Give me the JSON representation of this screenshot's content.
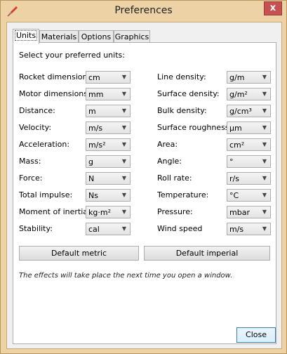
{
  "window": {
    "title": "Preferences",
    "close_glyph": "x"
  },
  "tabs": [
    {
      "label": "Units",
      "active": true
    },
    {
      "label": "Materials",
      "active": false
    },
    {
      "label": "Options",
      "active": false
    },
    {
      "label": "Graphics",
      "active": false
    }
  ],
  "units": {
    "intro": "Select your preferred units:",
    "left": [
      {
        "label": "Rocket dimensions:",
        "value": "cm"
      },
      {
        "label": "Motor dimensions:",
        "value": "mm"
      },
      {
        "label": "Distance:",
        "value": "m"
      },
      {
        "label": "Velocity:",
        "value": "m/s"
      },
      {
        "label": "Acceleration:",
        "value": "m/s²"
      },
      {
        "label": "Mass:",
        "value": "g"
      },
      {
        "label": "Force:",
        "value": "N"
      },
      {
        "label": "Total impulse:",
        "value": "Ns"
      },
      {
        "label": "Moment of inertia:",
        "value": "kg·m²"
      },
      {
        "label": "Stability:",
        "value": "cal"
      }
    ],
    "right": [
      {
        "label": "Line density:",
        "value": "g/m"
      },
      {
        "label": "Surface density:",
        "value": "g/m²"
      },
      {
        "label": "Bulk density:",
        "value": "g/cm³"
      },
      {
        "label": "Surface roughness:",
        "value": "µm"
      },
      {
        "label": "Area:",
        "value": "cm²"
      },
      {
        "label": "Angle:",
        "value": "°"
      },
      {
        "label": "Roll rate:",
        "value": "r/s"
      },
      {
        "label": "Temperature:",
        "value": "°C"
      },
      {
        "label": "Pressure:",
        "value": "mbar"
      },
      {
        "label": "Wind speed",
        "value": "m/s"
      }
    ],
    "default_metric": "Default metric",
    "default_imperial": "Default imperial",
    "note": "The effects will take place the next time you open a window."
  },
  "footer": {
    "close_label": "Close"
  },
  "colors": {
    "frame": "#ecd2a5",
    "close_x": "#c75050"
  }
}
